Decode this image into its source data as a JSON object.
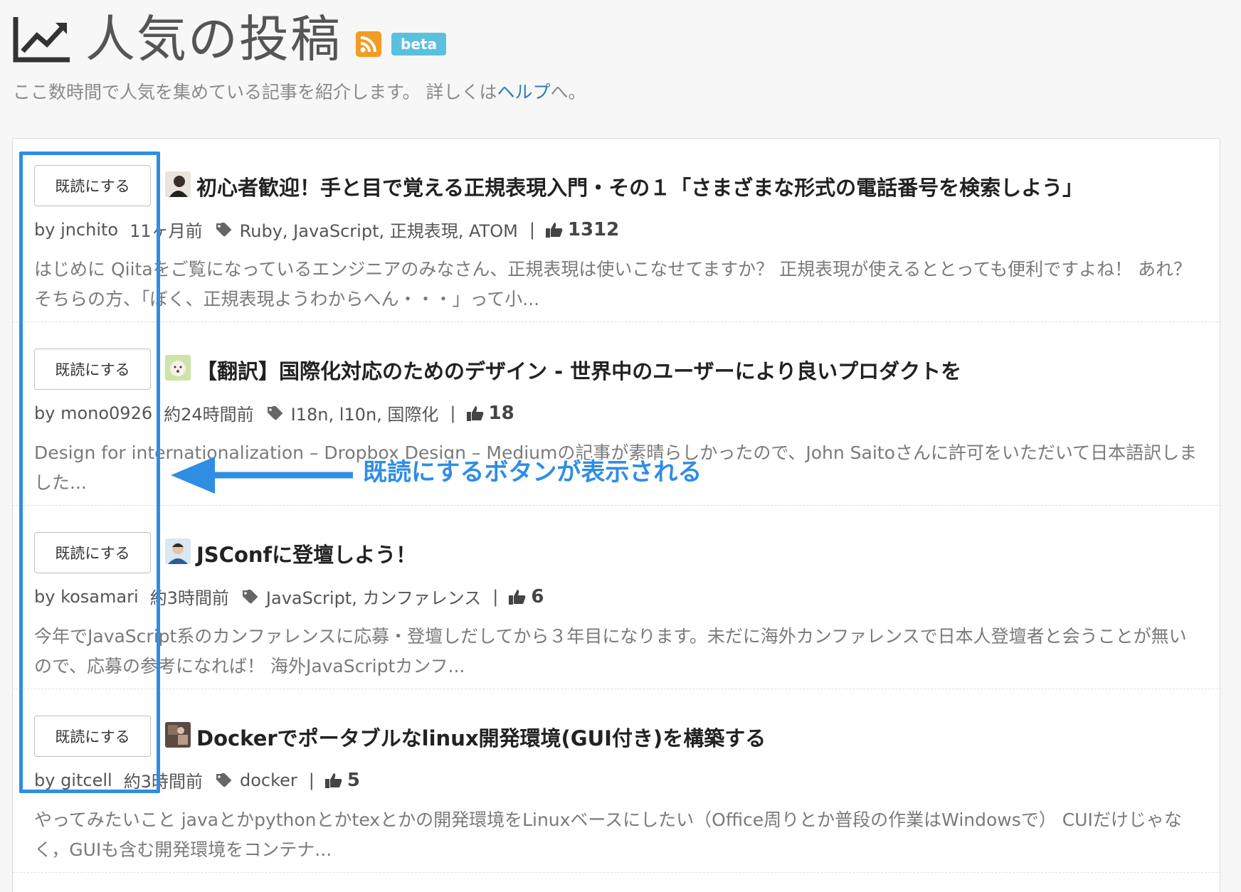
{
  "header": {
    "title": "人気の投稿",
    "beta_label": "beta",
    "subtitle_prefix": "ここ数時間で人気を集めている記事を紹介します。 詳しくは",
    "help_link": "ヘルプ",
    "subtitle_suffix": "へ。"
  },
  "colors": {
    "accent": "#2f8de4",
    "rss": "#f39c23",
    "beta": "#5bc0de",
    "link": "#337ab7"
  },
  "annotation": {
    "callout": "既読にするボタンが表示される"
  },
  "items": [
    {
      "button_label": "既読にする",
      "title": "初心者歓迎！手と目で覚える正規表現入門・その１「さまざまな形式の電話番号を検索しよう」",
      "author": "by jnchito",
      "time": "11ヶ月前",
      "tags": "Ruby, JavaScript, 正規表現, ATOM",
      "likes": "1312",
      "excerpt": "はじめに Qiitaをご覧になっているエンジニアのみなさん、正規表現は使いこなせてますか？ 正規表現が使えるととっても便利ですよね！ あれ？そちらの方、「ぼく、正規表現ようわからへん・・・」って小..."
    },
    {
      "button_label": "既読にする",
      "title": "【翻訳】国際化対応のためのデザイン - 世界中のユーザーにより良いプロダクトを",
      "author": "by mono0926",
      "time": "約24時間前",
      "tags": "I18n, l10n, 国際化",
      "likes": "18",
      "excerpt": "Design for internationalization – Dropbox Design – Mediumの記事が素晴らしかったので、John Saitoさんに許可をいただいて日本語訳しました..."
    },
    {
      "button_label": "既読にする",
      "title": "JSConfに登壇しよう！",
      "author": "by kosamari",
      "time": "約3時間前",
      "tags": "JavaScript, カンファレンス",
      "likes": "6",
      "excerpt": "今年でJavaScript系のカンファレンスに応募・登壇しだしてから３年目になります。未だに海外カンファレンスで日本人登壇者と会うことが無いので、応募の参考になれば！ 海外JavaScriptカンフ..."
    },
    {
      "button_label": "既読にする",
      "title": "Dockerでポータブルなlinux開発環境(GUI付き)を構築する",
      "author": "by gitcell",
      "time": "約3時間前",
      "tags": "docker",
      "likes": "5",
      "excerpt": "やってみたいこと javaとかpythonとかtexとかの開発環境をLinuxベースにしたい（Office周りとか普段の作業はWindowsで） CUIだけじゃなく，GUIも含む開発環境をコンテナ..."
    }
  ]
}
